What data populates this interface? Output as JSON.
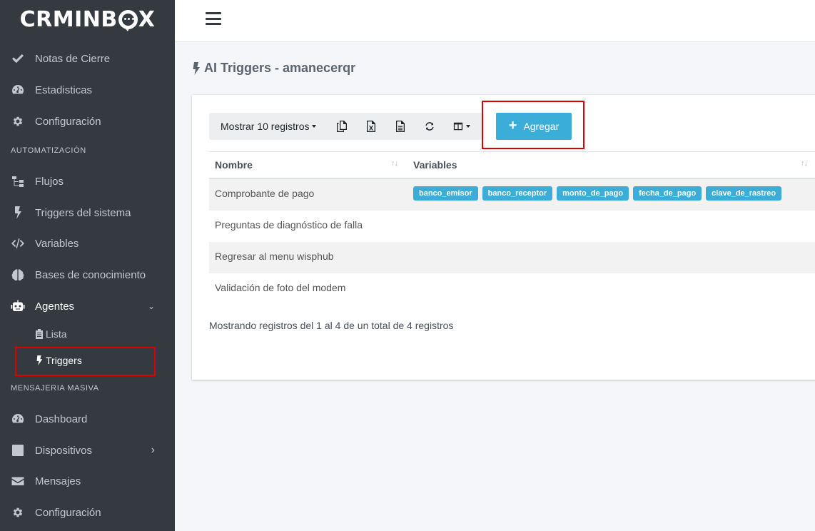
{
  "app": {
    "logo": "CRMINBOX"
  },
  "sidebar": {
    "items_top": [
      {
        "label": "Notas de Cierre",
        "icon": "check-icon"
      },
      {
        "label": "Estadisticas",
        "icon": "tachometer-icon"
      },
      {
        "label": "Configuración",
        "icon": "gear-icon"
      }
    ],
    "section_automation": "AUTOMATIZACIÓN",
    "items_automation": [
      {
        "label": "Flujos",
        "icon": "sitemap-icon"
      },
      {
        "label": "Triggers del sistema",
        "icon": "bolt-icon"
      },
      {
        "label": "Variables",
        "icon": "code-icon"
      },
      {
        "label": "Bases de conocimiento",
        "icon": "brain-icon"
      },
      {
        "label": "Agentes",
        "icon": "robot-icon"
      }
    ],
    "agentes_sub": [
      {
        "label": "Lista",
        "icon": "clipboard-icon"
      },
      {
        "label": "Triggers",
        "icon": "bolt-icon"
      }
    ],
    "section_mass": "MENSAJERIA MASIVA",
    "items_mass": [
      {
        "label": "Dashboard",
        "icon": "tachometer-icon"
      },
      {
        "label": "Dispositivos",
        "icon": "phone-icon"
      },
      {
        "label": "Mensajes",
        "icon": "envelope-icon"
      },
      {
        "label": "Configuración",
        "icon": "gear-icon"
      }
    ]
  },
  "page": {
    "title": "AI Triggers - amanecerqr"
  },
  "toolbar": {
    "show_label": "Mostrar 10 registros",
    "icons": [
      "copy-icon",
      "excel-icon",
      "csv-icon",
      "refresh-icon",
      "columns-icon"
    ],
    "add_label": "Agregar"
  },
  "table": {
    "columns": [
      "Nombre",
      "Variables"
    ],
    "rows": [
      {
        "nombre": "Comprobante de pago",
        "variables": [
          "banco_emisor",
          "banco_receptor",
          "monto_de_pago",
          "fecha_de_pago",
          "clave_de_rastreo"
        ]
      },
      {
        "nombre": "Preguntas de diagnóstico de falla",
        "variables": []
      },
      {
        "nombre": "Regresar al menu wisphub",
        "variables": []
      },
      {
        "nombre": "Validación de foto del modem",
        "variables": []
      }
    ],
    "info": "Mostrando registros del 1 al 4 de un total de 4 registros"
  },
  "colors": {
    "sidebar_bg": "#343a40",
    "accent": "#3aaed8",
    "highlight": "#dc0000"
  }
}
